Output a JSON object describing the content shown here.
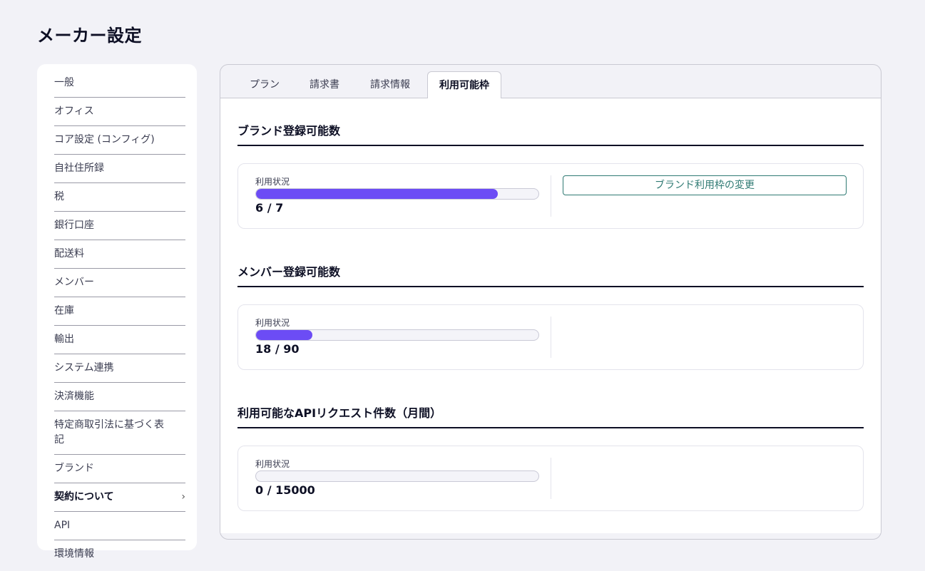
{
  "page_title": "メーカー設定",
  "sidebar": {
    "items": [
      {
        "label": "一般"
      },
      {
        "label": "オフィス"
      },
      {
        "label": "コア設定 (コンフィグ)"
      },
      {
        "label": "自社住所録"
      },
      {
        "label": "税"
      },
      {
        "label": "銀行口座"
      },
      {
        "label": "配送料"
      },
      {
        "label": "メンバー"
      },
      {
        "label": "在庫"
      },
      {
        "label": "輸出"
      },
      {
        "label": "システム連携"
      },
      {
        "label": "決済機能"
      },
      {
        "label": "特定商取引法に基づく表記"
      },
      {
        "label": "ブランド"
      },
      {
        "label": "契約について",
        "active": true
      },
      {
        "label": "API"
      },
      {
        "label": "環境情報"
      }
    ],
    "chevron_icon": "chevron-right-icon"
  },
  "tabs": [
    {
      "label": "プラン"
    },
    {
      "label": "請求書"
    },
    {
      "label": "請求情報"
    },
    {
      "label": "利用可能枠",
      "active": true
    }
  ],
  "sections": [
    {
      "title": "ブランド登録可能数",
      "usage_label": "利用状況",
      "used": 6,
      "limit": 7,
      "usage_text": "6 / 7",
      "button_label": "ブランド利用枠の変更"
    },
    {
      "title": "メンバー登録可能数",
      "usage_label": "利用状況",
      "used": 18,
      "limit": 90,
      "usage_text": "18 / 90"
    },
    {
      "title": "利用可能なAPIリクエスト件数（月間）",
      "usage_label": "利用状況",
      "used": 0,
      "limit": 15000,
      "usage_text": "0 / 15000"
    }
  ],
  "colors": {
    "accent": "#6c4cf5",
    "button_border": "#2f7a73",
    "background": "#f2f2f7"
  }
}
